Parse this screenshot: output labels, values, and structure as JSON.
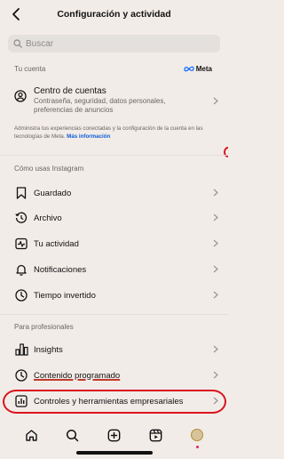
{
  "header": {
    "title": "Configuración y actividad"
  },
  "search": {
    "placeholder": "Buscar"
  },
  "account_section": {
    "label": "Tu cuenta",
    "meta_brand": "Meta",
    "accounts_center": {
      "title": "Centro de cuentas",
      "subtitle": "Contraseña, seguridad, datos personales, preferencias de anuncios"
    },
    "notice": {
      "text": "Administra tus experiencias conectadas y la configuración de la cuenta en las tecnologías de Meta. ",
      "link": "Más información"
    }
  },
  "usage_section": {
    "label": "Cómo usas Instagram",
    "items": [
      {
        "label": "Guardado",
        "icon": "bookmark-icon"
      },
      {
        "label": "Archivo",
        "icon": "archive-clock-icon"
      },
      {
        "label": "Tu actividad",
        "icon": "activity-icon"
      },
      {
        "label": "Notificaciones",
        "icon": "bell-icon"
      },
      {
        "label": "Tiempo invertido",
        "icon": "clock-icon"
      }
    ]
  },
  "pro_section": {
    "label": "Para profesionales",
    "items": [
      {
        "label": "Insights",
        "icon": "bar-chart-icon"
      },
      {
        "label": "Contenido programado",
        "icon": "scheduled-clock-icon"
      },
      {
        "label": "Controles y herramientas empresariales",
        "icon": "business-chart-icon"
      }
    ]
  },
  "tabbar": {
    "tabs": [
      "home-icon",
      "search-icon",
      "create-icon",
      "reels-icon",
      "profile-avatar"
    ]
  },
  "colors": {
    "background": "#f2ece8",
    "annotation": "#d9141e",
    "link": "#0b5cd6"
  }
}
